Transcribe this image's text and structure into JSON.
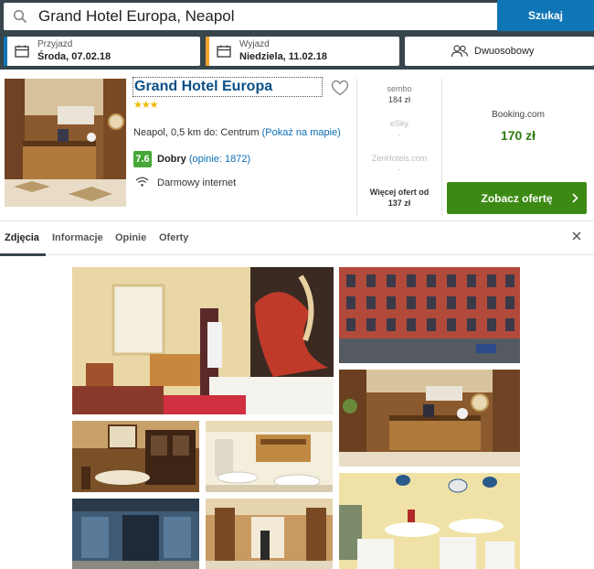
{
  "search": {
    "query": "Grand Hotel Europa, Neapol",
    "button_label": "Szukaj"
  },
  "checkin": {
    "label": "Przyjazd",
    "value": "Środa, 07.02.18",
    "accent": "#0f76b6"
  },
  "checkout": {
    "label": "Wyjazd",
    "value": "Niedziela, 11.02.18",
    "accent": "#f6a22e"
  },
  "room": {
    "label": "Dwuosobowy"
  },
  "hotel": {
    "name": "Grand Hotel Europa",
    "stars": "★★★",
    "location": "Neapol, 0,5 km do: Centrum",
    "map_link": "(Pokaż na mapie)",
    "score": "7.6",
    "rating_label": "Dobry",
    "reviews": "(opinie: 1872)",
    "amenity": "Darmowy internet"
  },
  "partners": [
    {
      "name": "sembo",
      "price": "184 zł",
      "dim": false
    },
    {
      "name": "eSky",
      "price": "-",
      "dim": true
    },
    {
      "name": "ZenHotels.com",
      "price": "-",
      "dim": true
    }
  ],
  "more_offers": {
    "line1": "Więcej ofert od",
    "line2": "137 zł"
  },
  "deal": {
    "site": "Booking.com",
    "price": "170 zł",
    "button_label": "Zobacz ofertę"
  },
  "tabs": [
    {
      "label": "Zdjęcia",
      "active": true
    },
    {
      "label": "Informacje",
      "active": false
    },
    {
      "label": "Opinie",
      "active": false
    },
    {
      "label": "Oferty",
      "active": false
    }
  ],
  "icons": [
    "search-icon",
    "calendar-icon",
    "people-icon",
    "heart-icon",
    "wifi-icon",
    "chevron-right-icon",
    "close-icon"
  ],
  "colors": {
    "topbar": "#37454d",
    "search_button": "#0f76b6",
    "offer_button": "#3c8a14",
    "score_badge": "#44a737",
    "link": "#0a6eb4"
  }
}
